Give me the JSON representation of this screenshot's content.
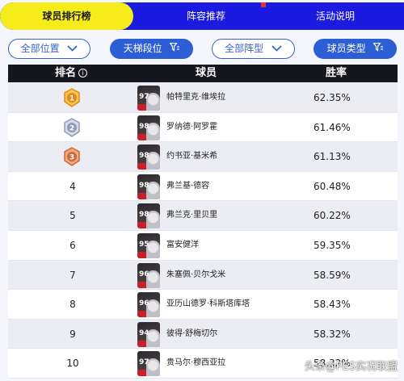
{
  "tabs": [
    {
      "label": "球员排行榜",
      "active": true
    },
    {
      "label": "阵容推荐",
      "active": false
    },
    {
      "label": "活动说明",
      "active": false
    }
  ],
  "filters": {
    "position": "全部位置",
    "ladder": "天梯段位",
    "formation": "全部阵型",
    "player_type": "球员类型"
  },
  "table": {
    "headers": {
      "rank": "排名",
      "player": "球员",
      "win_rate": "胜率"
    },
    "rows": [
      {
        "rank": "1",
        "medal": "gold",
        "ovr": "97",
        "tag": "",
        "name": "帕特里克·维埃拉",
        "win_rate": "62.35%"
      },
      {
        "rank": "2",
        "medal": "silver",
        "ovr": "98",
        "tag": "",
        "name": "罗纳德·阿罗霍",
        "win_rate": "61.46%"
      },
      {
        "rank": "3",
        "medal": "bronze",
        "ovr": "98",
        "tag": "",
        "name": "约书亚·基米希",
        "win_rate": "61.13%"
      },
      {
        "rank": "4",
        "medal": "",
        "ovr": "98",
        "tag": "",
        "name": "弗兰基·德容",
        "win_rate": "60.48%"
      },
      {
        "rank": "5",
        "medal": "",
        "ovr": "98",
        "tag": "",
        "name": "弗兰克·里贝里",
        "win_rate": "60.22%"
      },
      {
        "rank": "6",
        "medal": "",
        "ovr": "95",
        "tag": "",
        "name": "富安健洋",
        "win_rate": "59.35%"
      },
      {
        "rank": "7",
        "medal": "",
        "ovr": "96",
        "tag": "",
        "name": "朱塞佩·贝尔戈米",
        "win_rate": "58.59%"
      },
      {
        "rank": "8",
        "medal": "",
        "ovr": "96",
        "tag": "",
        "name": "亚历山德罗·科斯塔库塔",
        "win_rate": "58.43%"
      },
      {
        "rank": "9",
        "medal": "",
        "ovr": "94",
        "tag": "",
        "name": "彼得·舒梅切尔",
        "win_rate": "58.32%"
      },
      {
        "rank": "10",
        "medal": "",
        "ovr": "97",
        "tag": "",
        "name": "贵马尔·穆西亚拉",
        "win_rate": "58.32%"
      }
    ]
  },
  "watermark": "头条@PES实况联盟",
  "colors": {
    "tab_bar": "#1a1ae0",
    "tab_active": "#f5ec1a",
    "filter_blue": "#2c5fd6",
    "header_bg": "#16161e"
  }
}
